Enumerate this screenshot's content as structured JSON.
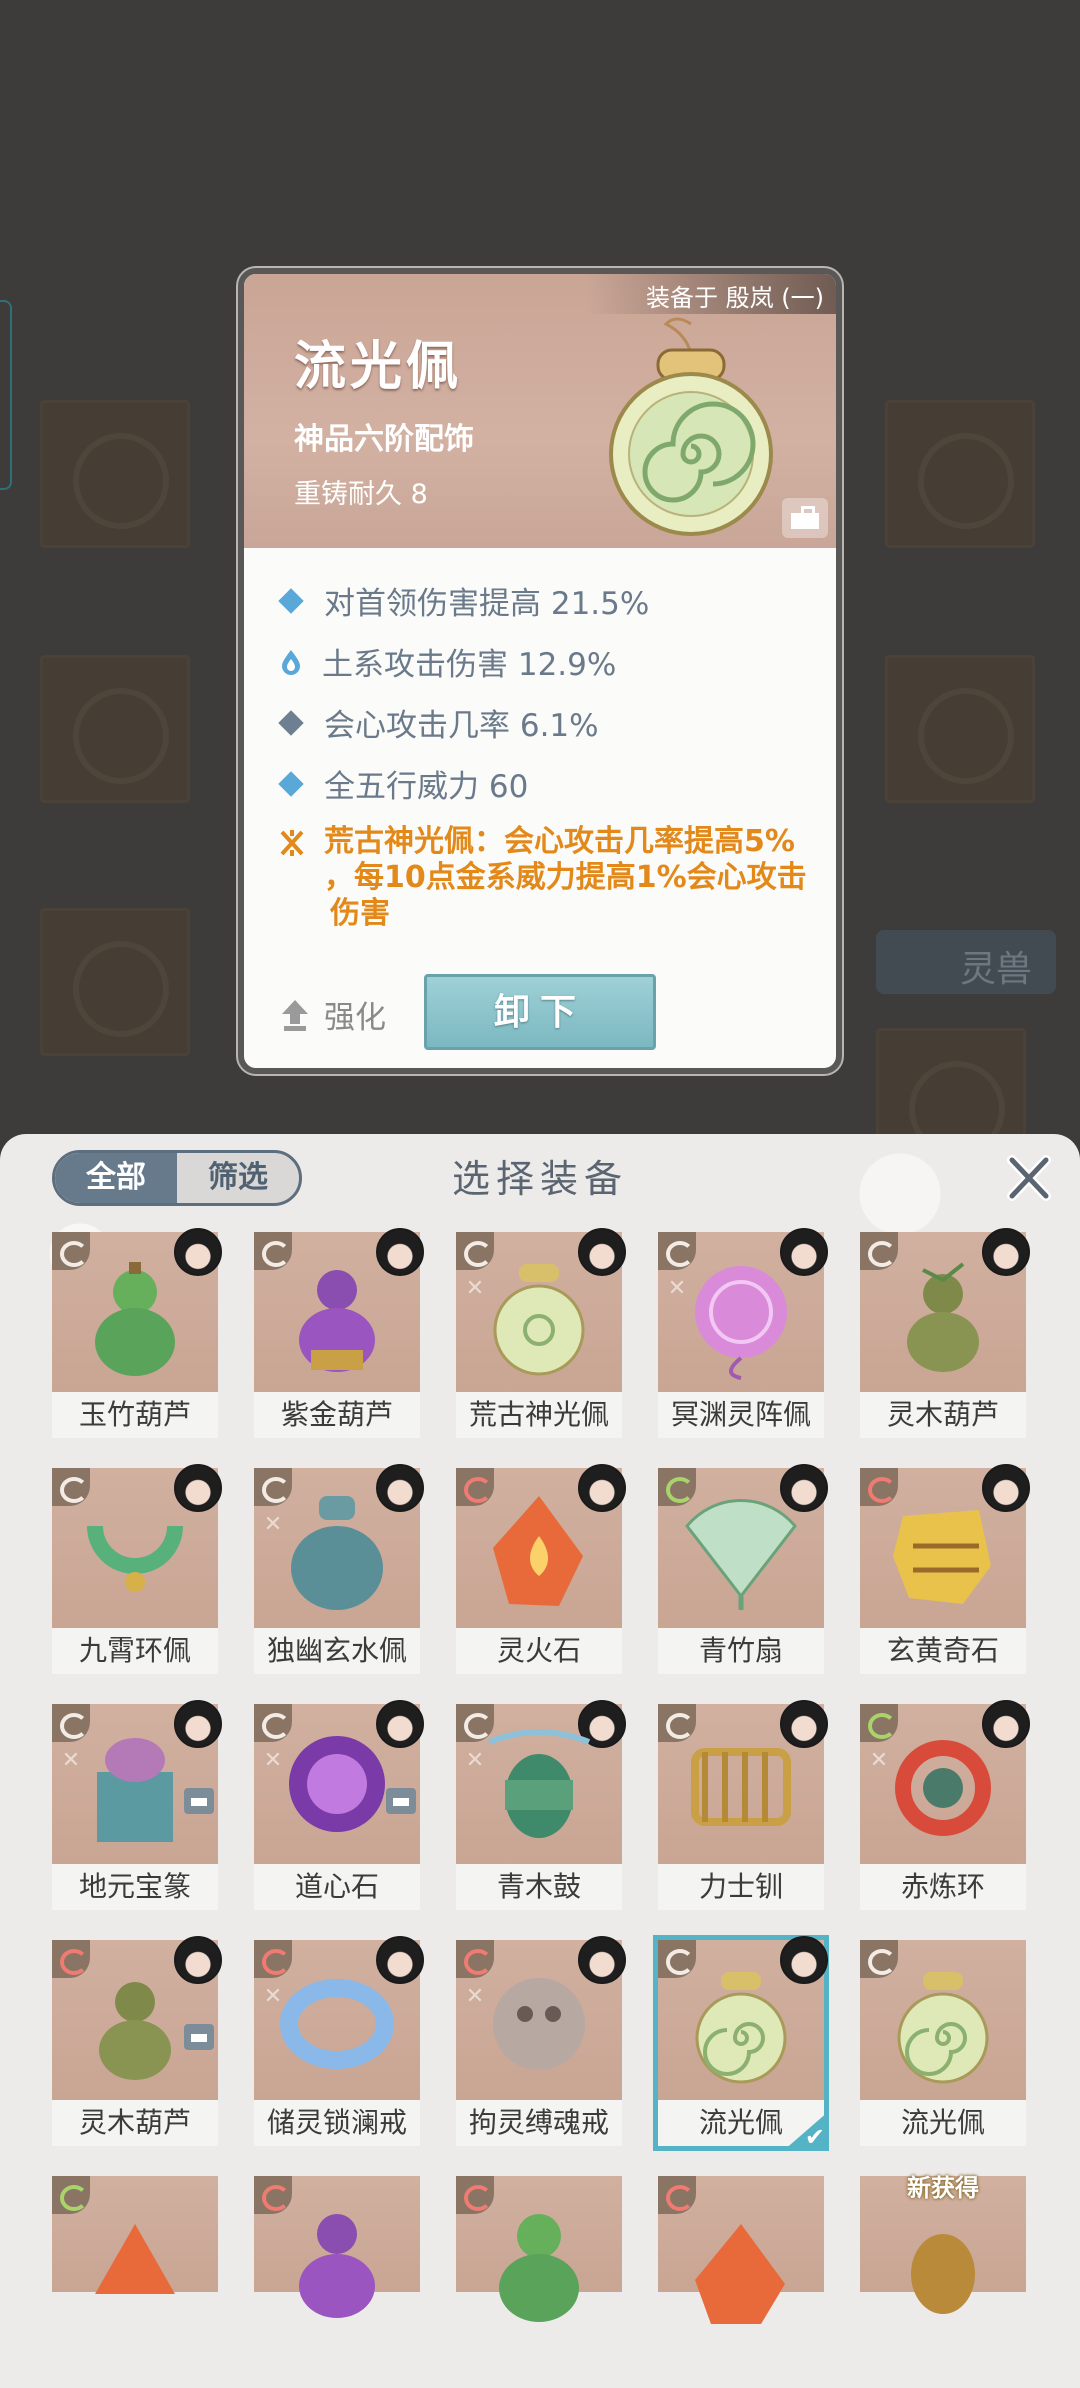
{
  "detail_card": {
    "equipped_on": "装备于 殷岚 (一)",
    "name": "流光佩",
    "grade": "神品六阶配饰",
    "durability": "重铸耐久 8",
    "stats": [
      "对首领伤害提高 21.5%",
      "土系攻击伤害 12.9%",
      "会心攻击几率 6.1%",
      "全五行威力 60"
    ],
    "special_lines": [
      "荒古神光佩：会心攻击几率提高5%",
      "，每10点金系威力提高1%会心攻击",
      "伤害"
    ],
    "upgrade_label": "强化",
    "unequip_label": "卸下",
    "colors": {
      "stat_text": "#6b7a8a",
      "special_text": "#e3891a",
      "diamond": "#5aa8d8"
    }
  },
  "background": {
    "pet_button_label": "灵兽"
  },
  "panel": {
    "title": "选择装备",
    "filter_tabs": [
      "全部",
      "筛选"
    ],
    "active_tab": "全部",
    "items": [
      {
        "name": "玉竹葫芦"
      },
      {
        "name": "紫金葫芦"
      },
      {
        "name": "荒古神光佩"
      },
      {
        "name": "冥渊灵阵佩"
      },
      {
        "name": "灵木葫芦"
      },
      {
        "name": "九霄环佩"
      },
      {
        "name": "独幽玄水佩"
      },
      {
        "name": "灵火石"
      },
      {
        "name": "青竹扇"
      },
      {
        "name": "玄黄奇石"
      },
      {
        "name": "地元宝篆"
      },
      {
        "name": "道心石"
      },
      {
        "name": "青木鼓"
      },
      {
        "name": "力士钏"
      },
      {
        "name": "赤炼环"
      },
      {
        "name": "灵木葫芦"
      },
      {
        "name": "储灵锁澜戒"
      },
      {
        "name": "拘灵缚魂戒"
      },
      {
        "name": "流光佩"
      },
      {
        "name": "流光佩"
      }
    ],
    "selected_index": 18,
    "new_badge": "新获得"
  }
}
